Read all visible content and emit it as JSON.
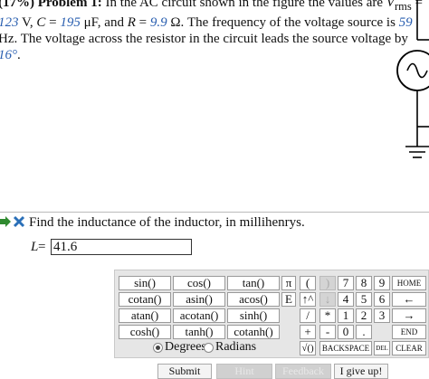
{
  "problem": {
    "label": "(17%)  Problem 1:",
    "t1": "In the AC circuit shown in the figure the values are ",
    "vrms_sym": "V",
    "vrms_sub": "rms",
    "eq": " = ",
    "vrms_val": "123",
    "t2": " V, ",
    "c_sym": "C",
    "c_val": "195",
    "t3": " μF, and ",
    "r_sym": "R",
    "r_val": "9.9",
    "t4": " Ω. The frequency of the voltage source is ",
    "f_val": "59",
    "t5": " Hz. The voltage across the resistor in the circuit leads the source voltage by ",
    "phase_val": "16°",
    "t6": "."
  },
  "question": {
    "text": "Find the inductance of the inductor, in millihenrys.",
    "var": "L",
    "eq": "=",
    "answer": "41.6"
  },
  "calculator": {
    "func_keys": [
      "sin()",
      "cos()",
      "tan()",
      "cotan()",
      "asin()",
      "acos()",
      "atan()",
      "acotan()",
      "sinh()",
      "cosh()",
      "tanh()",
      "cotanh()"
    ],
    "sym_keys": [
      "π",
      "(",
      ")",
      "E",
      "↑^",
      "↓",
      "/",
      "*",
      "-",
      "+"
    ],
    "num_keys": [
      "7",
      "8",
      "9",
      "4",
      "5",
      "6",
      "1",
      "2",
      "3",
      "0",
      "."
    ],
    "home": "HOME",
    "back_arrow": "←",
    "fwd_arrow": "→",
    "end": "END",
    "sqrt": "√()",
    "backspace": "BACKSPACE",
    "del": "DEL",
    "clear": "CLEAR",
    "degrees": "Degrees",
    "radians": "Radians"
  },
  "buttons": {
    "submit": "Submit",
    "hint": "Hint",
    "feedback": "Feedback",
    "giveup": "I give up!"
  }
}
